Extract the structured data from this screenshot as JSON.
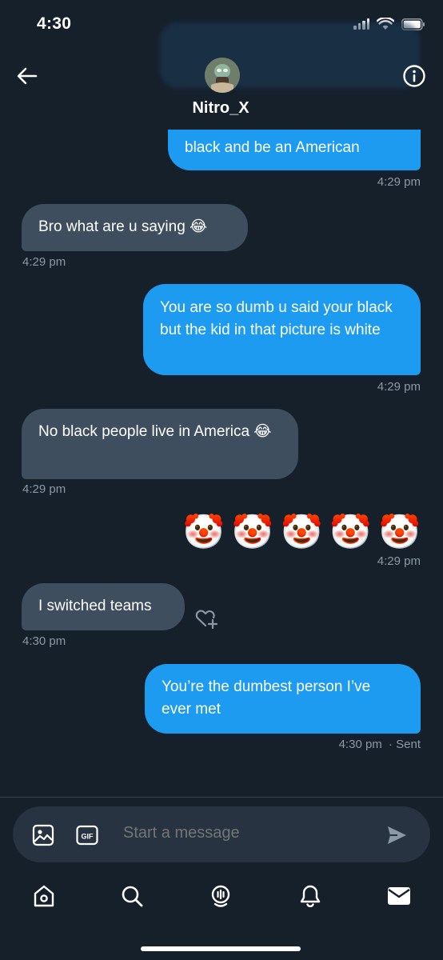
{
  "status_bar": {
    "time": "4:30"
  },
  "header": {
    "username": "Nitro_X"
  },
  "messages": [
    {
      "from": "me",
      "text": "black and be an American",
      "time": "4:29 pm"
    },
    {
      "from": "them",
      "text": "Bro what are u saying 😂",
      "time": "4:29 pm"
    },
    {
      "from": "me",
      "text": "You are so dumb u said your black but the kid in that picture is white",
      "time": "4:29 pm"
    },
    {
      "from": "them",
      "text": "No black people live in America 😂",
      "time": "4:29 pm"
    },
    {
      "from": "me",
      "text": "🤡🤡🤡🤡🤡",
      "time": "4:29 pm"
    },
    {
      "from": "them",
      "text": "I switched teams",
      "time": "4:30 pm"
    },
    {
      "from": "me",
      "text": "You’re the dumbest person I’ve ever met",
      "time": "4:30 pm",
      "status": "· Sent"
    }
  ],
  "clowns": [
    "🤡",
    "🤡",
    "🤡",
    "🤡",
    "🤡"
  ],
  "composer": {
    "placeholder": "Start a message"
  },
  "icons": {
    "back": "arrow-left-icon",
    "info": "info-icon",
    "image": "image-icon",
    "gif": "gif-icon",
    "gif_text": "GIF",
    "send": "send-icon",
    "react": "heart-plus-icon"
  },
  "tabs": [
    "home",
    "search",
    "spaces",
    "notifications",
    "messages"
  ],
  "colors": {
    "background": "#15202b",
    "sent_bubble": "#1d9bf0",
    "received_bubble": "#3e4e5e",
    "muted_text": "#8b98a5",
    "composer": "#273340"
  }
}
